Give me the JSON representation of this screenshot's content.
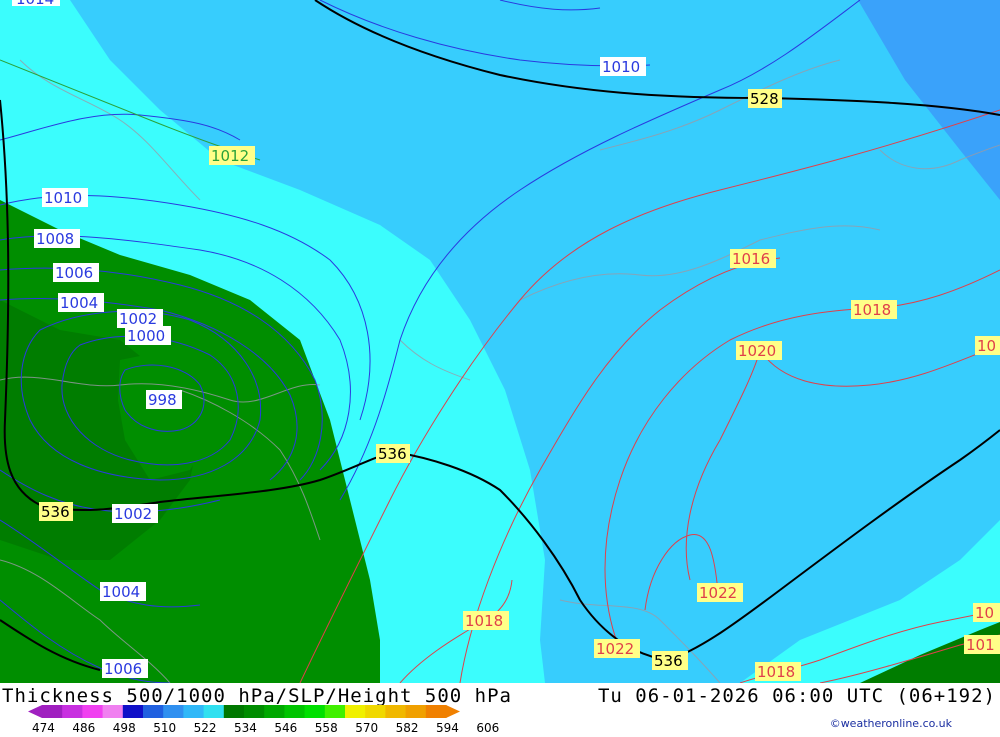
{
  "footer": {
    "title": "Thickness 500/1000 hPa/SLP/Height 500 hPa",
    "datetime": "Tu 06-01-2026 06:00 UTC (06+192)",
    "credit": "©weatheronline.co.uk"
  },
  "legend": {
    "ticks": [
      "474",
      "486",
      "498",
      "510",
      "522",
      "534",
      "546",
      "558",
      "570",
      "582",
      "594",
      "606"
    ],
    "colors": [
      "#a020c0",
      "#c830e0",
      "#f040f0",
      "#f080f0",
      "#1010c8",
      "#2060e0",
      "#3090f0",
      "#30b8f8",
      "#30e0f0",
      "#007800",
      "#008c00",
      "#00a800",
      "#00c400",
      "#00e000",
      "#40f000",
      "#f0f000",
      "#f0d800",
      "#f0b800",
      "#f0a000",
      "#f08000"
    ]
  },
  "map": {
    "fill_colors": {
      "thickness_528_534": "#37cdfd",
      "thickness_522_528": "#3aa2fa",
      "thickness_534_540": "#3bfdfd",
      "thickness_540_546_dark": "#007d00",
      "thickness_540_546_mid": "#008e00"
    },
    "slp_blue_labels": [
      "1010",
      "1010",
      "1008",
      "1006",
      "1004",
      "1002",
      "1000",
      "998",
      "1002",
      "1004",
      "1006"
    ],
    "slp_green_labels": [
      "1012"
    ],
    "slp_red_labels": [
      "1016",
      "1018",
      "1020",
      "1018",
      "1022",
      "1022",
      "1018",
      "10",
      "10",
      "101"
    ],
    "height_labels": [
      "528",
      "536",
      "536",
      "536"
    ],
    "top_partial_label": "1014"
  }
}
